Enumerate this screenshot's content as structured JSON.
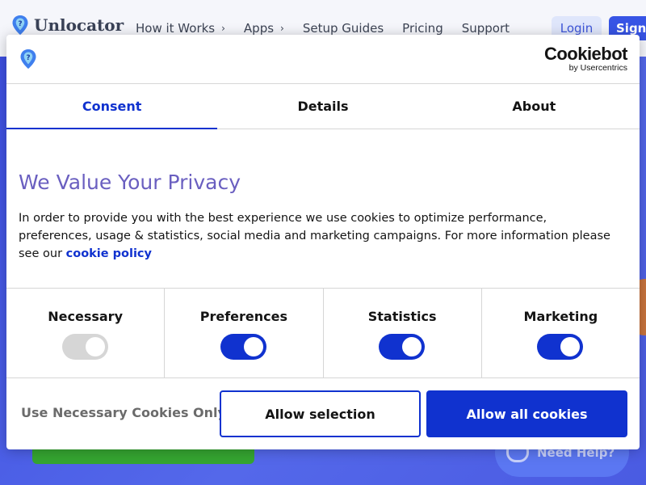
{
  "site": {
    "brand": "Unlocator",
    "nav": [
      {
        "label": "How it Works",
        "has_chevron": true
      },
      {
        "label": "Apps",
        "has_chevron": true
      },
      {
        "label": "Setup Guides",
        "has_chevron": false
      },
      {
        "label": "Pricing",
        "has_chevron": false
      },
      {
        "label": "Support",
        "has_chevron": false
      }
    ],
    "login_label": "Login",
    "signup_label": "Sign",
    "help_label": "Need Help?"
  },
  "dialog": {
    "vendor_name": "Cookiebot",
    "vendor_sub": "by Usercentrics",
    "tabs": [
      {
        "label": "Consent",
        "active": true
      },
      {
        "label": "Details",
        "active": false
      },
      {
        "label": "About",
        "active": false
      }
    ],
    "title": "We Value Your Privacy",
    "text": "In order to provide you with the best experience we use cookies to optimize performance, preferences, usage & statistics, social media and marketing campaigns. For more information please see our",
    "link_text": "cookie policy",
    "toggles": [
      {
        "label": "Necessary",
        "on": true,
        "disabled": true
      },
      {
        "label": "Preferences",
        "on": true,
        "disabled": false
      },
      {
        "label": "Statistics",
        "on": true,
        "disabled": false
      },
      {
        "label": "Marketing",
        "on": true,
        "disabled": false
      }
    ],
    "buttons": {
      "necessary": "Use Necessary Cookies Only",
      "selection": "Allow selection",
      "all": "Allow all cookies"
    }
  },
  "colors": {
    "accent": "#1032cf",
    "title": "#6a5fc0",
    "hero": "#4a5ce6",
    "green": "#35a531"
  }
}
